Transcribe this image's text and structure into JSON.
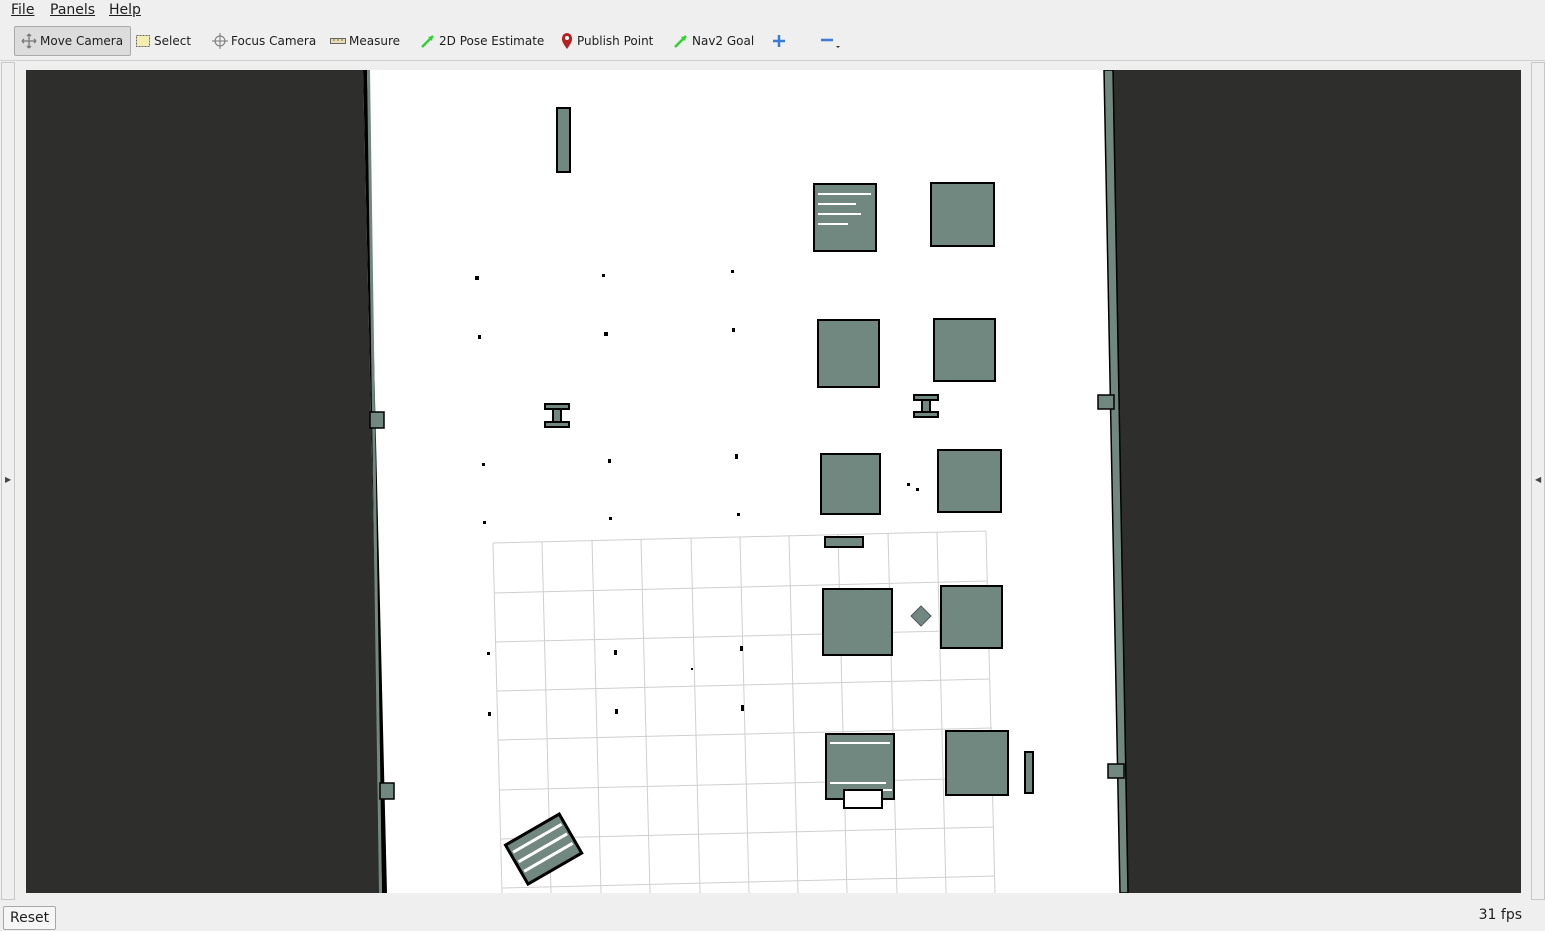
{
  "menu": [
    "File",
    "Panels",
    "Help"
  ],
  "toolbar": {
    "move_camera": "Move Camera",
    "select": "Select",
    "focus_camera": "Focus Camera",
    "measure": "Measure",
    "pose_estimate": "2D Pose Estimate",
    "publish_point": "Publish Point",
    "nav2_goal": "Nav2 Goal",
    "active_tool": "Move Camera"
  },
  "status": {
    "reset_label": "Reset",
    "fps": "31 fps"
  },
  "colors": {
    "background": "#2e2e2c",
    "free_space": "#ffffff",
    "obstacle": "#708880",
    "wall_edge": "#000000",
    "grid": "#cfcfcf",
    "pose_arrow": "#2ed12e",
    "publish_pin": "#b52121",
    "add_tool": "#3a7bd5"
  }
}
